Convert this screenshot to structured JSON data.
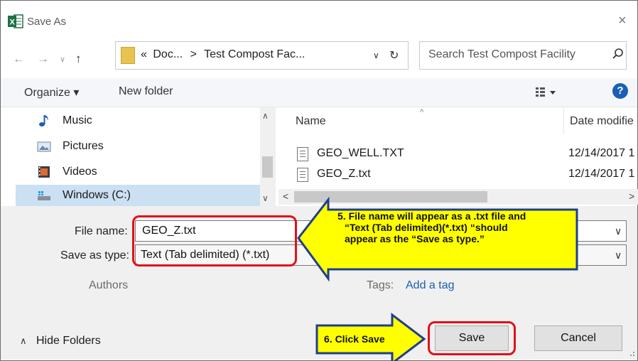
{
  "window": {
    "title": "Save As",
    "close_glyph": "×"
  },
  "address": {
    "crumb_prefix": "«",
    "crumb_doc": "Doc...",
    "separator": ">",
    "crumb_folder": "Test Compost Fac...",
    "search_placeholder": "Search Test Compost Facility"
  },
  "toolbar": {
    "organize_label": "Organize ▾",
    "new_folder_label": "New folder",
    "help_label": "?"
  },
  "nav_pane": {
    "items": [
      {
        "label": "Music",
        "icon": "music-icon"
      },
      {
        "label": "Pictures",
        "icon": "pictures-icon"
      },
      {
        "label": "Videos",
        "icon": "videos-icon"
      },
      {
        "label": "Windows (C:)",
        "icon": "drive-icon",
        "selected": true
      }
    ]
  },
  "file_list": {
    "columns": {
      "name": "Name",
      "date": "Date modifie"
    },
    "files": [
      {
        "name": "GEO_WELL.TXT",
        "date": "12/14/2017 1"
      },
      {
        "name": "GEO_Z.txt",
        "date": "12/14/2017 1"
      }
    ]
  },
  "form": {
    "file_name_label": "File name:",
    "file_name_value": "GEO_Z.txt",
    "save_type_label": "Save as type:",
    "save_type_value": "Text (Tab delimited) (*.txt)",
    "authors_label": "Authors",
    "tags_label": "Tags:",
    "tags_link": "Add a tag"
  },
  "footer": {
    "hide_folders_label": "Hide Folders",
    "save_label": "Save",
    "cancel_label": "Cancel"
  },
  "annotations": {
    "callout5_line1": "5.  File name will appear as a .txt file and",
    "callout5_line2": "“Text (Tab delimited)(*.txt) “should",
    "callout5_line3": "appear as the “Save as type.”",
    "callout6": "6.  Click Save"
  },
  "colors": {
    "callout_fill": "#ffff00",
    "callout_stroke": "#1f3e8c",
    "highlight_red": "#e3101a",
    "accent_blue": "#1a5fb4",
    "excel_green": "#1e7145"
  }
}
